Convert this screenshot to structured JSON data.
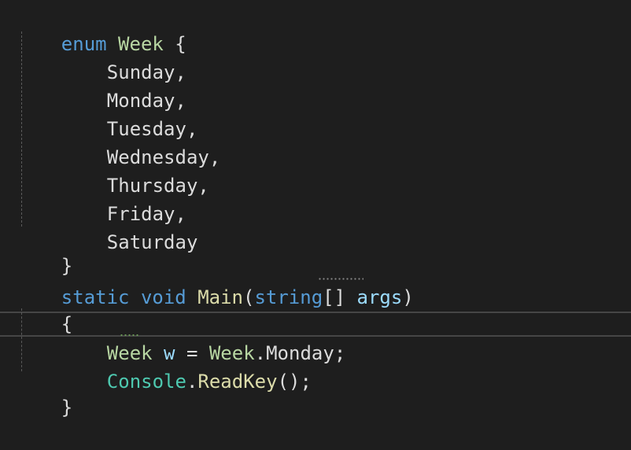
{
  "code": {
    "enum_keyword": "enum",
    "enum_name": "Week",
    "open_brace": "{",
    "close_brace": "}",
    "members": [
      "Sunday,",
      "Monday,",
      "Tuesday,",
      "Wednesday,",
      "Thursday,",
      "Friday,",
      "Saturday"
    ],
    "static_keyword": "static",
    "void_keyword": "void",
    "method_name": "Main",
    "open_paren": "(",
    "string_keyword": "string",
    "array_brackets": "[]",
    "param_name": "args",
    "close_paren": ")",
    "stmt1_type": "Week",
    "stmt1_var": "w",
    "stmt1_assign": " = ",
    "stmt1_enum": "Week",
    "stmt1_dot": ".",
    "stmt1_member": "Monday",
    "stmt1_semicolon": ";",
    "stmt2_class": "Console",
    "stmt2_dot": ".",
    "stmt2_method": "ReadKey",
    "stmt2_parens": "()",
    "stmt2_semicolon": ";"
  },
  "colors": {
    "background": "#1e1e1e",
    "keyword": "#569cd6",
    "type": "#4ec9b0",
    "enum_type": "#b8d7a3",
    "method": "#dcdcaa",
    "parameter": "#9cdcfe",
    "plain": "#dcdcdc"
  }
}
